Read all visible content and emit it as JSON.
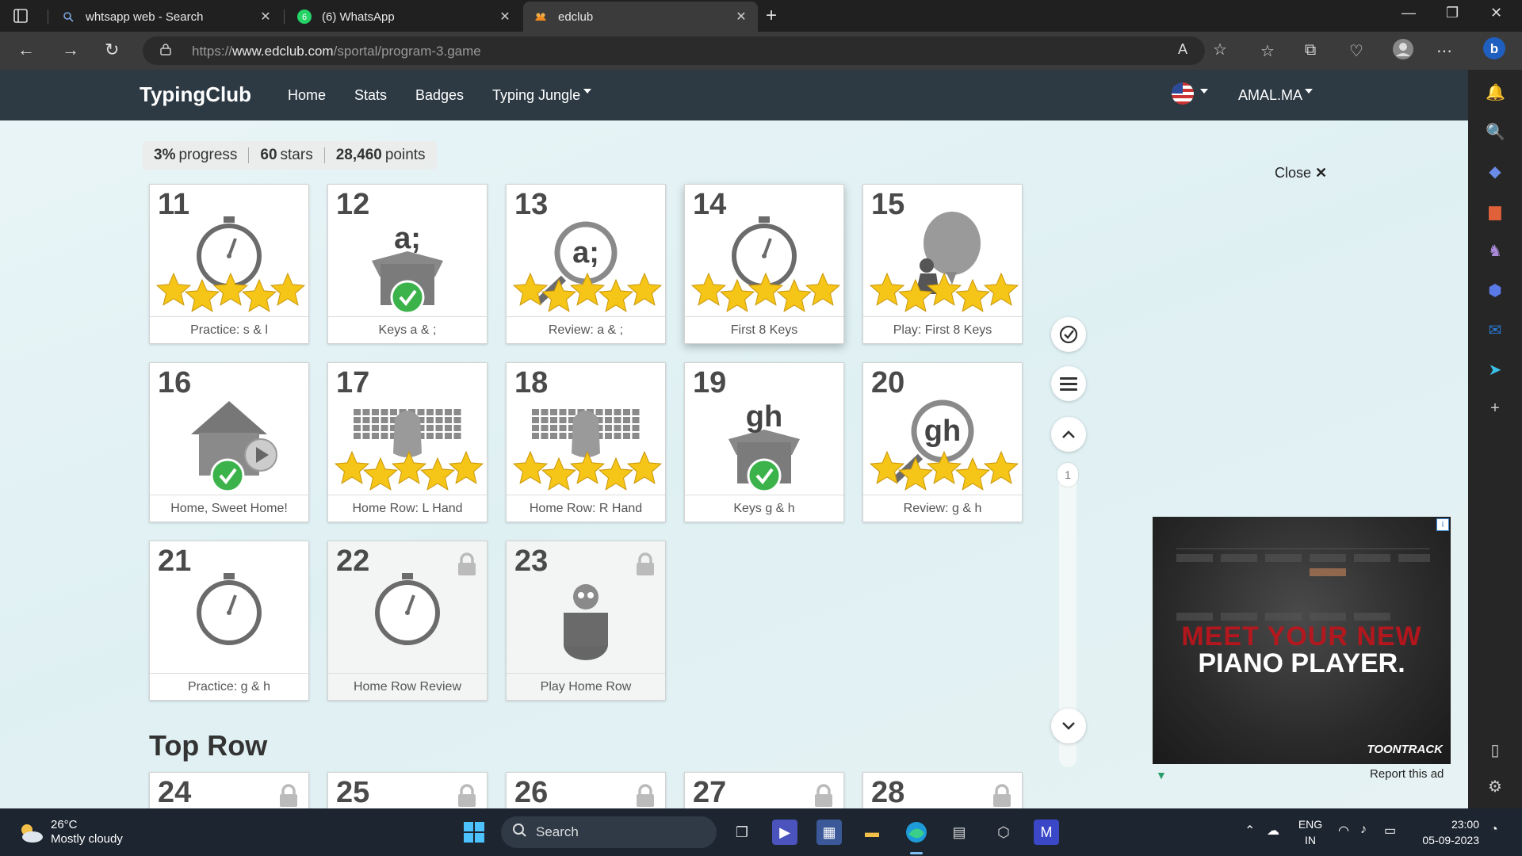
{
  "browser": {
    "tabs": [
      {
        "label": "whtsapp web - Search",
        "icon": "search-icon"
      },
      {
        "label": "(6) WhatsApp",
        "icon": "whatsapp-icon"
      },
      {
        "label": "edclub",
        "icon": "edclub-icon",
        "active": true
      }
    ],
    "url_prefix": "https://",
    "url_host": "www.edclub.com",
    "url_path": "/sportal/program-3.game"
  },
  "nav": {
    "brand": "TypingClub",
    "links": [
      "Home",
      "Stats",
      "Badges",
      "Typing Jungle"
    ],
    "user": "AMAL.MA"
  },
  "stats": {
    "progress_value": "3%",
    "progress_label": "progress",
    "stars_value": "60",
    "stars_label": "stars",
    "points_value": "28,460",
    "points_label": "points"
  },
  "lessons": [
    {
      "num": "11",
      "caption": "Practice: s & l",
      "art": "stopwatch",
      "stars": 5
    },
    {
      "num": "12",
      "caption": "Keys a & ;",
      "art": "box",
      "box_text": "a;",
      "done": true
    },
    {
      "num": "13",
      "caption": "Review: a & ;",
      "art": "magnifier",
      "mag_text": "a;",
      "stars": 5
    },
    {
      "num": "14",
      "caption": "First 8 Keys",
      "art": "stopwatch",
      "stars": 5,
      "highlight": true
    },
    {
      "num": "15",
      "caption": "Play: First 8 Keys",
      "art": "balloon",
      "stars": 5
    },
    {
      "num": "16",
      "caption": "Home, Sweet Home!",
      "art": "house",
      "done": true
    },
    {
      "num": "17",
      "caption": "Home Row: L Hand",
      "art": "keyboard",
      "stars": 5
    },
    {
      "num": "18",
      "caption": "Home Row: R Hand",
      "art": "keyboard",
      "stars": 5
    },
    {
      "num": "19",
      "caption": "Keys g & h",
      "art": "box",
      "box_text": "gh",
      "done": true
    },
    {
      "num": "20",
      "caption": "Review: g & h",
      "art": "magnifier",
      "mag_text": "gh",
      "stars": 5
    },
    {
      "num": "21",
      "caption": "Practice: g & h",
      "art": "stopwatch"
    },
    {
      "num": "22",
      "caption": "Home Row Review",
      "art": "stopwatch",
      "locked": true
    },
    {
      "num": "23",
      "caption": "Play Home Row",
      "art": "jar",
      "locked": true
    }
  ],
  "section": {
    "title": "Top Row",
    "next_nums": [
      "24",
      "25",
      "26",
      "27",
      "28"
    ]
  },
  "side_controls": {
    "page": "1"
  },
  "ad": {
    "close_label": "Close",
    "line1": "MEET YOUR NEW",
    "line2": "PIANO PLAYER.",
    "brand": "TOONTRACK",
    "report": "Report this ad",
    "info": "i"
  },
  "taskbar": {
    "temp": "26°C",
    "condition": "Mostly cloudy",
    "search": "Search",
    "lang1": "ENG",
    "lang2": "IN",
    "time": "23:00",
    "date": "05-09-2023"
  },
  "colors": {
    "nav_bg": "#2d3a44",
    "star": "#f5c518",
    "check": "#3bb34a",
    "icon_gray": "#6b6b6b"
  }
}
